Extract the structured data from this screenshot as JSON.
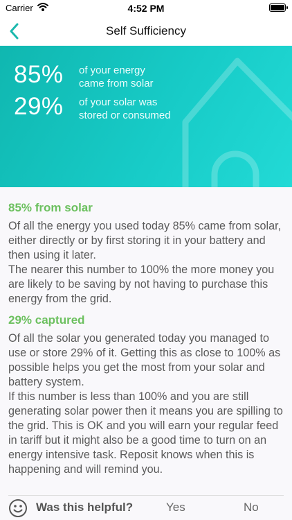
{
  "status_bar": {
    "carrier": "Carrier",
    "time": "4:52 PM"
  },
  "nav": {
    "title": "Self Sufficiency",
    "back_icon": "chevron-left-icon"
  },
  "hero": {
    "stats": [
      {
        "value": "85%",
        "line1": "of your energy",
        "line2": "came from solar"
      },
      {
        "value": "29%",
        "line1": "of your solar was",
        "line2": "stored or consumed"
      }
    ]
  },
  "sections": [
    {
      "title": "85% from solar",
      "paragraphs": [
        "Of all the energy you used today 85% came from solar, either directly or by first storing it in your battery and then using it later.",
        "The nearer this number to 100% the more money you are likely to be saving by not having to purchase this energy from the grid."
      ]
    },
    {
      "title": "29% captured",
      "paragraphs": [
        "Of all the solar you generated today you managed to use or store 29% of it. Getting this as close to 100% as possible helps you get the most from your solar and battery system.",
        "If this number is less than 100% and you are still generating solar power then it means you are spilling to the grid. This is OK and you will earn your regular feed in tariff but it might also be a good time to turn on an energy intensive task. Reposit knows when this is happening and will remind you."
      ]
    }
  ],
  "feedback": {
    "question": "Was this helpful?",
    "yes": "Yes",
    "no": "No"
  },
  "colors": {
    "accent": "#1bb8ad",
    "hero": "#17cbc7",
    "section_title": "#6cc05f"
  }
}
